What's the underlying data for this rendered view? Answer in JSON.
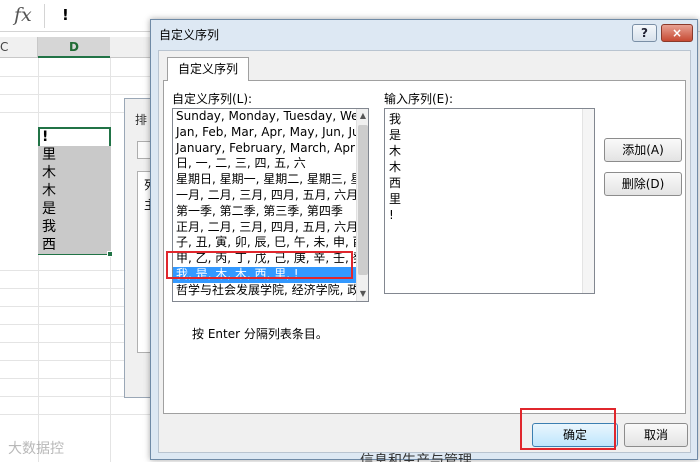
{
  "formula_bar": {
    "fx_label": "fx",
    "value": "!"
  },
  "sheet": {
    "columns": [
      "C",
      "D"
    ],
    "cells": [
      "!",
      "里",
      "木",
      "木",
      "是",
      "我",
      "西"
    ]
  },
  "sort_dialog": {
    "title": "排",
    "rows": [
      "列",
      "主"
    ]
  },
  "dialog": {
    "title": "自定义序列",
    "help": "?",
    "close": "×",
    "tab": "自定义序列",
    "custom_lists_label": "自定义序列(L):",
    "entries_label": "输入序列(E):",
    "custom_lists": [
      "Sunday, Monday, Tuesday, Wed",
      "Jan, Feb, Mar, Apr, May, Jun, Ju",
      "January, February, March, April",
      "日, 一, 二, 三, 四, 五, 六",
      "星期日, 星期一, 星期二, 星期三, 星",
      "一月, 二月, 三月, 四月, 五月, 六月,",
      "第一季, 第二季, 第三季, 第四季",
      "正月, 二月, 三月, 四月, 五月, 六月,",
      "子, 丑, 寅, 卯, 辰, 巳, 午, 未, 申, 酉",
      "甲, 乙, 丙, 丁, 戊, 己, 庚, 辛, 壬, 癸",
      "我, 是, 木, 木, 西, 里, !",
      "哲学与社会发展学院, 经济学院, 政"
    ],
    "selected_index": 10,
    "entries": [
      "我",
      "是",
      "木",
      "木",
      "西",
      "里",
      "!"
    ],
    "add_button": "添加(A)",
    "delete_button": "删除(D)",
    "hint": "按 Enter 分隔列表条目。",
    "ok_button": "确定",
    "cancel_button": "取消"
  },
  "watermark": "大数据控",
  "bottom_text": "信息和生产与管理"
}
